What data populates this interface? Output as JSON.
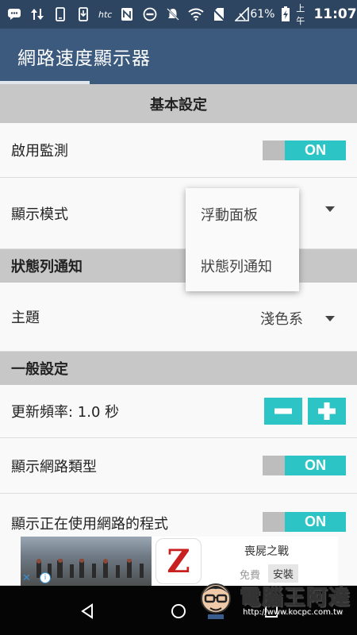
{
  "status_bar": {
    "carrier": "htc",
    "battery": "61%",
    "ampm": "上午",
    "time": "11:07",
    "icons": [
      "chat-icon",
      "data-transfer-icon",
      "phone-icon",
      "download-icon",
      "htc-logo",
      "nfc-icon",
      "do-not-disturb-icon",
      "mute-icon",
      "wifi-icon",
      "no-sim-icon",
      "signal-icon",
      "battery-charging-icon"
    ]
  },
  "app": {
    "title": "網路速度顯示器"
  },
  "sections": {
    "basic": "基本設定",
    "statusbar_notify": "狀態列通知",
    "general": "一般設定"
  },
  "rows": {
    "enable_monitor": {
      "label": "啟用監測",
      "toggle": "ON"
    },
    "display_mode": {
      "label": "顯示模式"
    },
    "theme": {
      "label": "主題",
      "value": "淺色系"
    },
    "update_rate": {
      "label": "更新頻率: 1.0 秒"
    },
    "show_network_type": {
      "label": "顯示網路類型",
      "toggle": "ON"
    },
    "show_apps_using_network": {
      "label": "顯示正在使用網路的程式",
      "toggle": "ON"
    }
  },
  "popup": {
    "options": [
      "浮動面板",
      "狀態列通知"
    ]
  },
  "ad": {
    "title": "喪屍之戰",
    "free": "免費",
    "install": "安裝"
  },
  "watermark": {
    "name": "電腦王阿達",
    "url": "http://www.kocpc.com.tw"
  },
  "colors": {
    "status_bar": "#2d4560",
    "app_bar": "#3b5a7e",
    "accent": "#2cc4c4",
    "section": "#c7c7c7"
  }
}
